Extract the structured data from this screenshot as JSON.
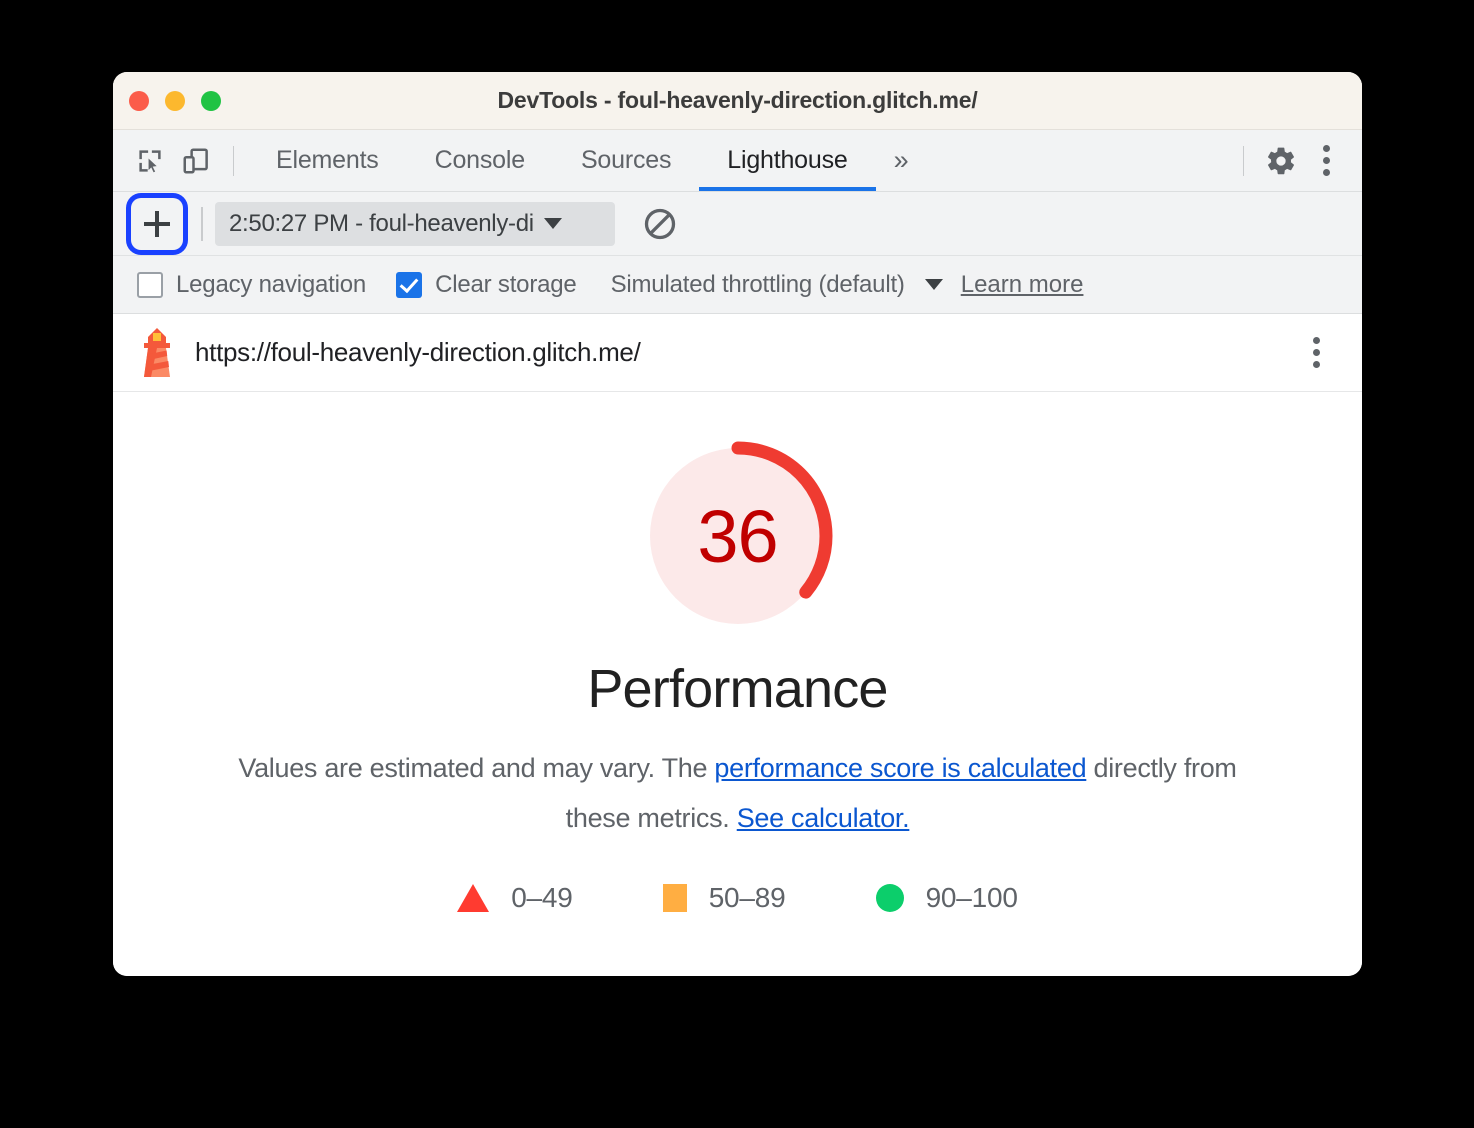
{
  "window": {
    "title": "DevTools - foul-heavenly-direction.glitch.me/",
    "traffic_lights": [
      "close",
      "minimize",
      "maximize"
    ]
  },
  "toolbar_icons": {
    "inspect": "inspect-element-icon",
    "device": "device-toolbar-icon",
    "settings": "gear-icon",
    "more": "more-options-icon"
  },
  "tabs": [
    {
      "label": "Elements",
      "active": false
    },
    {
      "label": "Console",
      "active": false
    },
    {
      "label": "Sources",
      "active": false
    },
    {
      "label": "Lighthouse",
      "active": true
    }
  ],
  "tab_overflow_label": "»",
  "lighthouse_toolbar": {
    "new_report_label": "+",
    "report_select_value": "2:50:27 PM - foul-heavenly-di",
    "clear_icon": "clear-all-icon"
  },
  "options": {
    "legacy_navigation": {
      "label": "Legacy navigation",
      "checked": false
    },
    "clear_storage": {
      "label": "Clear storage",
      "checked": true
    },
    "throttling": {
      "label": "Simulated throttling (default)"
    },
    "learn_more": "Learn more"
  },
  "report": {
    "url": "https://foul-heavenly-direction.glitch.me/",
    "lighthouse_icon": "lighthouse-icon",
    "menu_icon": "report-menu-icon",
    "disclaimer_pre": "Values are estimated and may vary. The ",
    "disclaimer_link1": "performance score is calculated",
    "disclaimer_mid": " directly from these metrics. ",
    "disclaimer_link2": "See calculator."
  },
  "chart_data": {
    "type": "pie",
    "title": "Performance",
    "categories": [
      "Performance"
    ],
    "values": [
      36
    ],
    "score": 36,
    "max": 100,
    "score_color": "#c00000",
    "arc_color": "#ef3b31",
    "track_color": "#fce9e9",
    "legend_position": "bottom",
    "legend": [
      {
        "shape": "triangle",
        "color": "#ff3b30",
        "label": "0–49",
        "range": [
          0,
          49
        ]
      },
      {
        "shape": "square",
        "color": "#ffae42",
        "label": "50–89",
        "range": [
          50,
          89
        ]
      },
      {
        "shape": "circle",
        "color": "#0cce6b",
        "label": "90–100",
        "range": [
          90,
          100
        ]
      }
    ]
  }
}
